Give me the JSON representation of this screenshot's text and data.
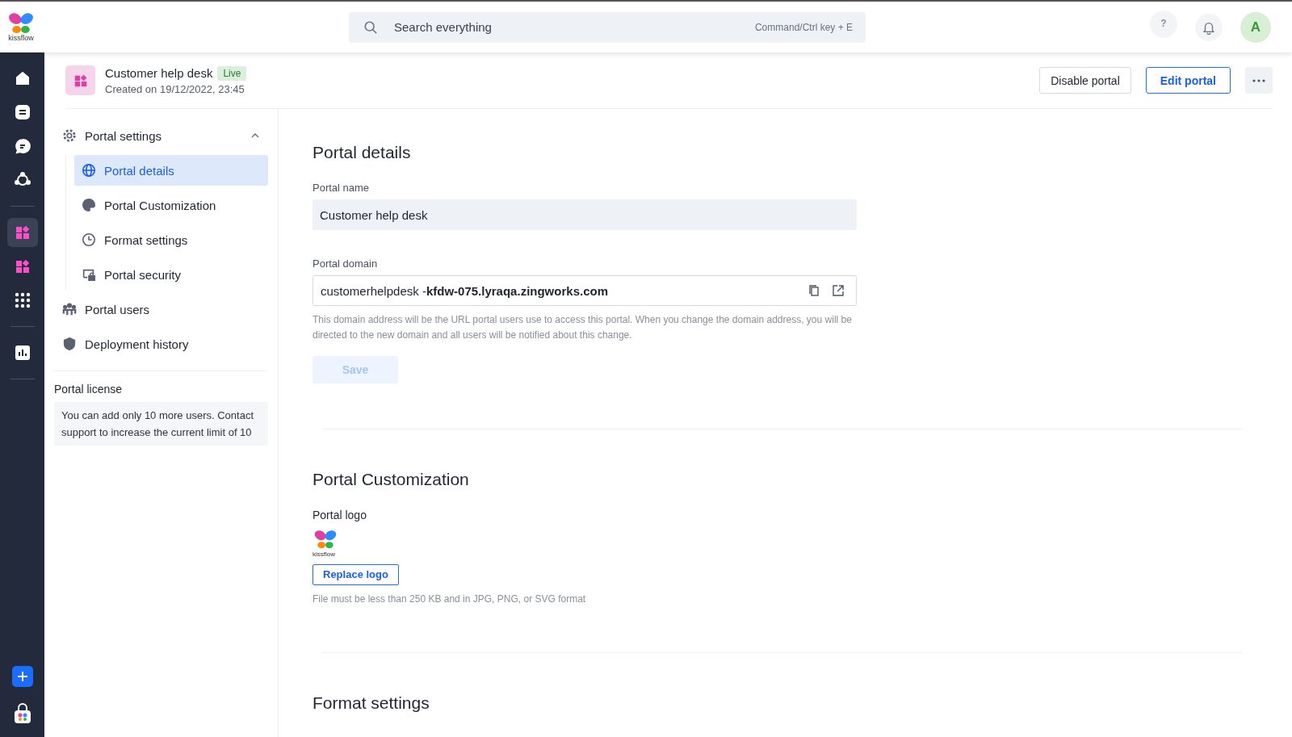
{
  "topbar": {
    "logo_text": "kissflow",
    "search": {
      "placeholder": "Search everything",
      "shortcut": "Command/Ctrl key + E"
    },
    "help": "?",
    "avatar": "A"
  },
  "rail": [
    {
      "kind": "home",
      "selected": false
    },
    {
      "kind": "tasks",
      "selected": false
    },
    {
      "kind": "chat",
      "selected": false
    },
    {
      "kind": "network",
      "selected": false
    },
    {
      "kind": "divider"
    },
    {
      "kind": "portal",
      "selected": true
    },
    {
      "kind": "portal",
      "selected": false
    },
    {
      "kind": "grid",
      "selected": false
    },
    {
      "kind": "divider"
    },
    {
      "kind": "chart",
      "selected": false
    },
    {
      "kind": "divider"
    }
  ],
  "header": {
    "title": "Customer help desk",
    "status": "Live",
    "created": "Created on 19/12/2022, 23:45",
    "buttons": [
      {
        "label": "Disable portal",
        "kind": "secondary"
      },
      {
        "label": "Edit portal",
        "kind": "primary"
      }
    ]
  },
  "nav": [
    {
      "label": "Portal settings",
      "kind": "gear",
      "expanded": true,
      "selected": false,
      "children": [
        {
          "label": "Portal details",
          "kind": "globe",
          "selected": true
        },
        {
          "label": "Portal Customization",
          "kind": "palette",
          "selected": false
        },
        {
          "label": "Format settings",
          "kind": "clock",
          "selected": false
        },
        {
          "label": "Portal security",
          "kind": "lock",
          "selected": false
        }
      ]
    },
    {
      "label": "Portal users",
      "kind": "users",
      "selected": false
    },
    {
      "label": "Deployment history",
      "kind": "shield",
      "selected": false
    }
  ],
  "license": {
    "title": "Portal license",
    "text": "You can add only 10 more users. Contact support to increase the current limit of 10"
  },
  "details": {
    "title": "Portal details",
    "name_label": "Portal name",
    "name_value": "Customer help desk",
    "domain_label": "Portal domain",
    "domain_value": "customerhelpdesk -**kfdw-075.lyraqa.zingworks.com**",
    "domain_help": "This domain address will be the URL portal users use to access this portal. When you change the domain address, you will be directed to the new domain and all users will be notified about this change.",
    "save": {
      "label": "Save",
      "disabled": true
    }
  },
  "customization": {
    "title": "Portal Customization",
    "logo_label": "Portal logo",
    "logo_text": "kissflow",
    "replace": "Replace logo",
    "hint": "File must be less than 250 KB and in JPG, PNG, or SVG format"
  },
  "format": {
    "title": "Format settings"
  }
}
